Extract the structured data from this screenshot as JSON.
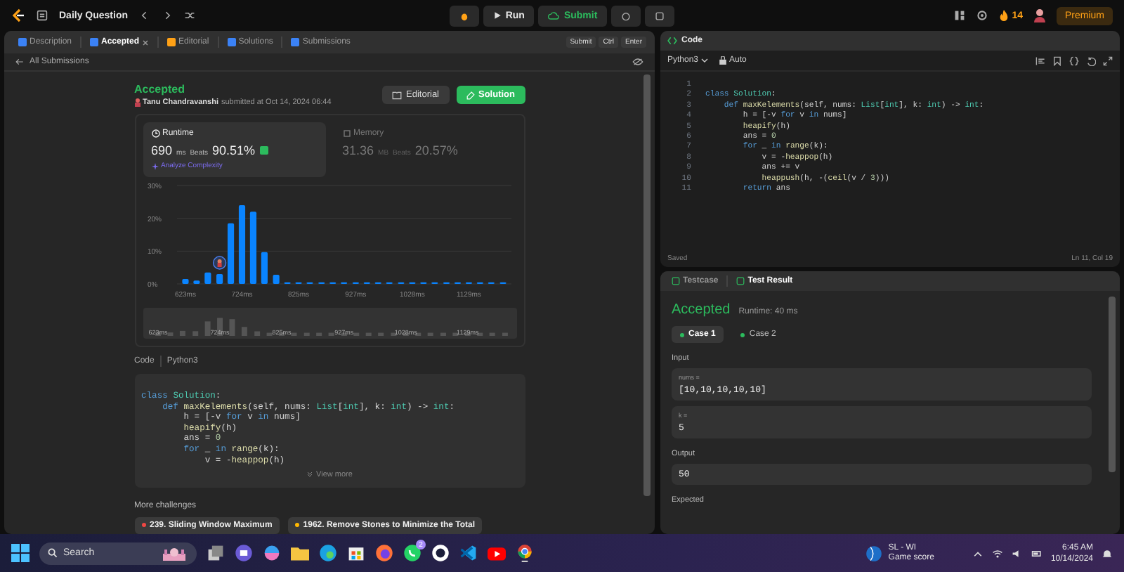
{
  "top_bar": {
    "title": "Daily Question",
    "run": "Run",
    "submit": "Submit",
    "streak": "14",
    "premium": "Premium"
  },
  "left_tabs": [
    {
      "label": "Description",
      "selected": false
    },
    {
      "label": "Accepted",
      "selected": true
    },
    {
      "label": "Editorial",
      "selected": false
    },
    {
      "label": "Solutions",
      "selected": false
    },
    {
      "label": "Submissions",
      "selected": false
    }
  ],
  "shortcut": [
    "Submit",
    "Ctrl",
    "Enter"
  ],
  "back_link": "All Submissions",
  "submission": {
    "status": "Accepted",
    "author": "Tanu Chandravanshi",
    "submitted": "submitted at Oct 14, 2024 06:44",
    "editorial": "Editorial",
    "solution": "Solution"
  },
  "stats": [
    {
      "kind": "runtime",
      "title": "Runtime",
      "value": "690",
      "unit": "ms",
      "beats_label": "Beats",
      "beats": "90.51%",
      "link": "Analyze Complexity",
      "selected": true
    },
    {
      "kind": "memory",
      "title": "Memory",
      "value": "31.36",
      "unit": "MB",
      "beats_label": "Beats",
      "beats": "20.57%",
      "selected": false
    }
  ],
  "chart_data": {
    "type": "bar",
    "x": [
      623,
      643,
      663,
      684,
      704,
      724,
      744,
      764,
      785,
      805,
      825,
      845,
      866,
      886,
      906,
      927,
      947,
      967,
      987,
      1008,
      1028,
      1048,
      1068,
      1089,
      1109,
      1129,
      1149,
      1169,
      1190
    ],
    "series": [
      {
        "color": "#0a84ff",
        "values": [
          1.5,
          1,
          3.5,
          3,
          18.5,
          24,
          22,
          9.7,
          2.8,
          0.5,
          0.5,
          0.5,
          0.5,
          0.5,
          0.5,
          0.5,
          0.5,
          0.5,
          0.5,
          0.5,
          0.5,
          0.5,
          0.5,
          0.5,
          0.5,
          0.5,
          0.5,
          0.5,
          0.5
        ]
      }
    ],
    "xlim": [
      608,
      1205
    ],
    "ylim": [
      0,
      30
    ],
    "yticks": [
      {
        "value": 0,
        "label": "0%"
      },
      {
        "value": 10,
        "label": "10%"
      },
      {
        "value": 20,
        "label": "20%"
      },
      {
        "value": 30,
        "label": "30%"
      }
    ],
    "xticks": [
      {
        "value": 623,
        "label": "623ms"
      },
      {
        "value": 724,
        "label": "724ms"
      },
      {
        "value": 825,
        "label": "825ms"
      },
      {
        "value": 927,
        "label": "927ms"
      },
      {
        "value": 1028,
        "label": "1028ms"
      },
      {
        "value": 1129,
        "label": "1129ms"
      }
    ]
  },
  "navigator_labels": [
    "623ms",
    "724ms",
    "825ms",
    "927ms",
    "1028ms",
    "1129ms"
  ],
  "code_preview": {
    "title": "Code",
    "language": "Python3",
    "view_more": "View more",
    "lines": [
      [
        {
          "text": "class ",
          "kind": "keyword"
        },
        {
          "text": "Solution",
          "kind": "type"
        },
        {
          "text": ":",
          "kind": "plain"
        }
      ],
      [
        {
          "text": "    def ",
          "kind": "keyword"
        },
        {
          "text": "maxKelements",
          "kind": "function"
        },
        {
          "text": "(self, nums: ",
          "kind": "plain"
        },
        {
          "text": "List",
          "kind": "type"
        },
        {
          "text": "[",
          "kind": "plain"
        },
        {
          "text": "int",
          "kind": "type"
        },
        {
          "text": "], k: ",
          "kind": "plain"
        },
        {
          "text": "int",
          "kind": "type"
        },
        {
          "text": ") -> ",
          "kind": "plain"
        },
        {
          "text": "int",
          "kind": "type"
        },
        {
          "text": ":",
          "kind": "plain"
        }
      ],
      [
        {
          "text": "        h = [-v ",
          "kind": "plain"
        },
        {
          "text": "for ",
          "kind": "keyword"
        },
        {
          "text": "v ",
          "kind": "plain"
        },
        {
          "text": "in ",
          "kind": "keyword"
        },
        {
          "text": "nums]",
          "kind": "plain"
        }
      ],
      [
        {
          "text": "        heapify",
          "kind": "function"
        },
        {
          "text": "(h)",
          "kind": "plain"
        }
      ],
      [
        {
          "text": "        ans = ",
          "kind": "plain"
        },
        {
          "text": "0",
          "kind": "number"
        }
      ],
      [
        {
          "text": "        for ",
          "kind": "keyword"
        },
        {
          "text": "_ ",
          "kind": "plain"
        },
        {
          "text": "in ",
          "kind": "keyword"
        },
        {
          "text": "range",
          "kind": "function"
        },
        {
          "text": "(k):",
          "kind": "plain"
        }
      ],
      [
        {
          "text": "            v = -",
          "kind": "plain"
        },
        {
          "text": "heappop",
          "kind": "function"
        },
        {
          "text": "(h)",
          "kind": "plain"
        }
      ]
    ]
  },
  "more_challenges": {
    "title": "More challenges",
    "items": [
      {
        "label": "239. Sliding Window Maximum",
        "color": "#ef4743"
      },
      {
        "label": "1962. Remove Stones to Minimize the Total",
        "color": "#ffb800"
      }
    ]
  },
  "editor": {
    "title": "Code",
    "language": "Python3",
    "mode": "Auto",
    "status": "Saved",
    "cursor": "Ln 11, Col 19",
    "lines": [
      {
        "num": "1"
      },
      {
        "num": "2",
        "code": [
          {
            "text": "class ",
            "kind": "keyword"
          },
          {
            "text": "Solution",
            "kind": "type"
          },
          {
            "text": ":",
            "kind": "plain"
          }
        ]
      },
      {
        "num": "3",
        "code": [
          {
            "text": "    def ",
            "kind": "keyword"
          },
          {
            "text": "maxKelements",
            "kind": "function"
          },
          {
            "text": "(self, nums: ",
            "kind": "plain"
          },
          {
            "text": "List",
            "kind": "type"
          },
          {
            "text": "[",
            "kind": "plain"
          },
          {
            "text": "int",
            "kind": "type"
          },
          {
            "text": "], k: ",
            "kind": "plain"
          },
          {
            "text": "int",
            "kind": "type"
          },
          {
            "text": ") -> ",
            "kind": "plain"
          },
          {
            "text": "int",
            "kind": "type"
          },
          {
            "text": ":",
            "kind": "plain"
          }
        ]
      },
      {
        "num": "4",
        "code": [
          {
            "text": "        h = [-v ",
            "kind": "plain"
          },
          {
            "text": "for ",
            "kind": "keyword"
          },
          {
            "text": "v ",
            "kind": "plain"
          },
          {
            "text": "in ",
            "kind": "keyword"
          },
          {
            "text": "nums]",
            "kind": "plain"
          }
        ]
      },
      {
        "num": "5",
        "code": [
          {
            "text": "        heapify",
            "kind": "function"
          },
          {
            "text": "(h)",
            "kind": "plain"
          }
        ]
      },
      {
        "num": "6",
        "code": [
          {
            "text": "        ans = ",
            "kind": "plain"
          },
          {
            "text": "0",
            "kind": "number"
          }
        ]
      },
      {
        "num": "7",
        "code": [
          {
            "text": "        for ",
            "kind": "keyword"
          },
          {
            "text": "_ ",
            "kind": "plain"
          },
          {
            "text": "in ",
            "kind": "keyword"
          },
          {
            "text": "range",
            "kind": "function"
          },
          {
            "text": "(k):",
            "kind": "plain"
          }
        ]
      },
      {
        "num": "8",
        "code": [
          {
            "text": "            v = -",
            "kind": "plain"
          },
          {
            "text": "heappop",
            "kind": "function"
          },
          {
            "text": "(h)",
            "kind": "plain"
          }
        ]
      },
      {
        "num": "9",
        "code": [
          {
            "text": "            ans += v",
            "kind": "plain"
          }
        ]
      },
      {
        "num": "10",
        "code": [
          {
            "text": "            heappush",
            "kind": "function"
          },
          {
            "text": "(h, -(",
            "kind": "plain"
          },
          {
            "text": "ceil",
            "kind": "function"
          },
          {
            "text": "(v / ",
            "kind": "plain"
          },
          {
            "text": "3",
            "kind": "number"
          },
          {
            "text": ")))",
            "kind": "plain"
          }
        ]
      },
      {
        "num": "11",
        "code": [
          {
            "text": "        return ",
            "kind": "keyword"
          },
          {
            "text": "ans",
            "kind": "plain"
          }
        ]
      }
    ]
  },
  "result": {
    "tabs": [
      {
        "label": "Testcase",
        "selected": false
      },
      {
        "label": "Test Result",
        "selected": true
      }
    ],
    "status": "Accepted",
    "runtime": "Runtime: 40 ms",
    "cases": [
      {
        "label": "Case 1",
        "selected": true
      },
      {
        "label": "Case 2",
        "selected": false
      }
    ],
    "input_label": "Input",
    "params": [
      {
        "name": "nums =",
        "value": "[10,10,10,10,10]"
      },
      {
        "name": "k =",
        "value": "5"
      }
    ],
    "output_label": "Output",
    "output": "50",
    "expected_label": "Expected"
  },
  "taskbar": {
    "search": "Search",
    "chat_badge": "2",
    "weather_title": "SL - WI",
    "weather_subtitle": "Game score",
    "time": "6:45 AM",
    "date": "10/14/2024"
  }
}
